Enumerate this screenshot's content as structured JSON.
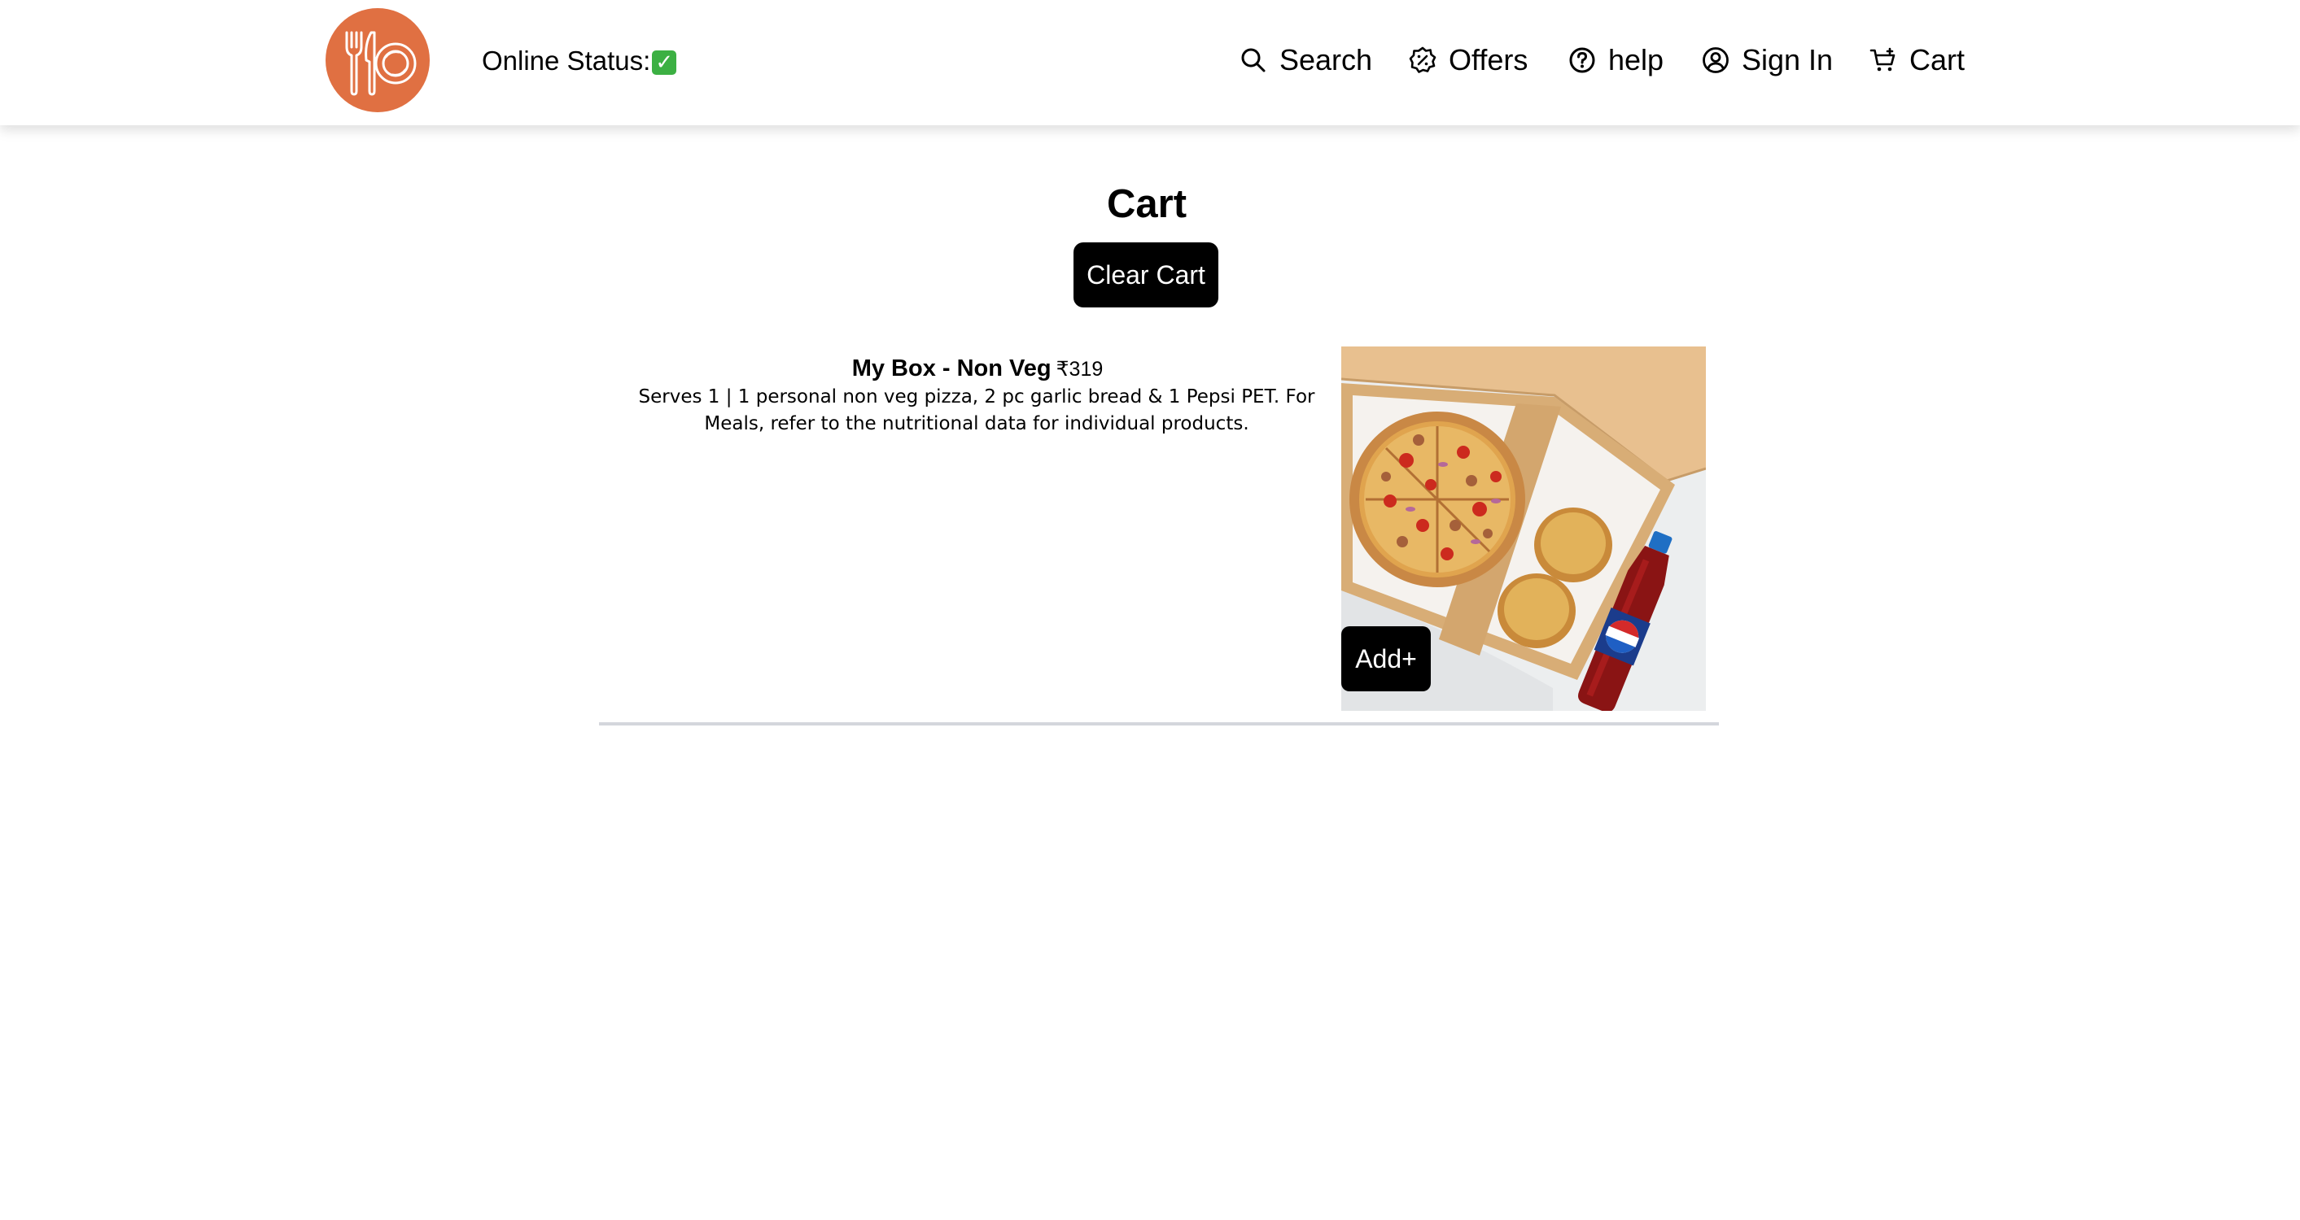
{
  "header": {
    "online_status_label": "Online Status:",
    "online_status_value": "✅",
    "nav": [
      {
        "label": "Search",
        "icon": "search-icon"
      },
      {
        "label": "Offers",
        "icon": "offers-icon"
      },
      {
        "label": "help",
        "icon": "help-icon"
      },
      {
        "label": "Sign In",
        "icon": "user-icon"
      },
      {
        "label": "Cart",
        "icon": "cart-icon"
      }
    ]
  },
  "main": {
    "title": "Cart",
    "clear_button": "Clear Cart",
    "items": [
      {
        "name": "My Box - Non Veg",
        "price": "₹319",
        "description": "Serves 1 | 1 personal non veg pizza, 2 pc garlic bread & 1 Pepsi PET. For Meals, refer to the nutritional data for individual products.",
        "add_button": "Add+"
      }
    ]
  },
  "colors": {
    "brand": "#e07042",
    "button": "#000000",
    "divider": "#d4d6dc"
  }
}
